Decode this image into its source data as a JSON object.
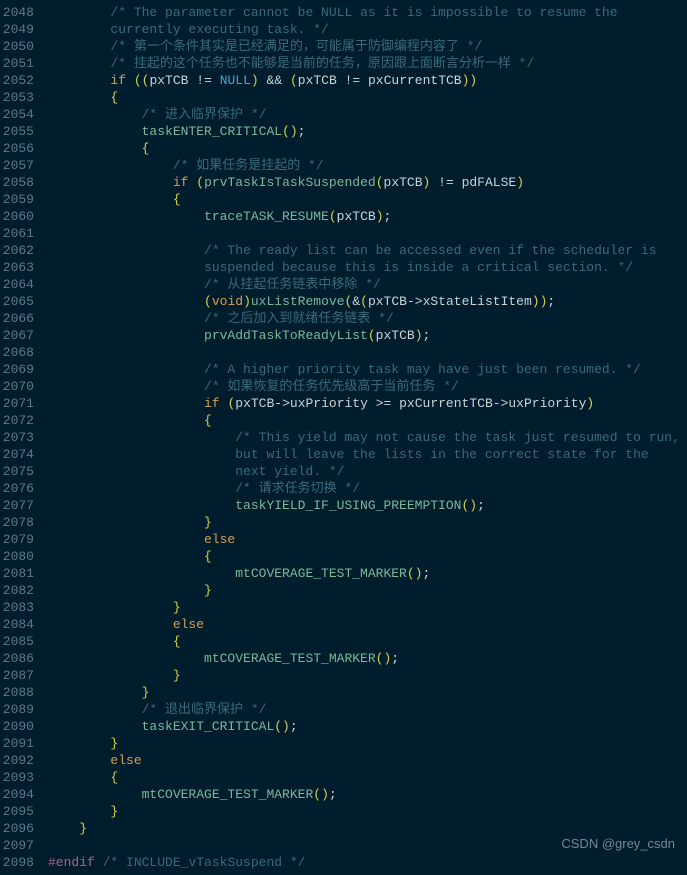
{
  "watermark": "CSDN @grey_csdn",
  "lines": [
    {
      "n": 2048,
      "i": 2,
      "seg": [
        {
          "c": "c-comment",
          "t": "/* The parameter cannot be NULL as it is impossible to resume the"
        }
      ]
    },
    {
      "n": 2049,
      "i": 2,
      "seg": [
        {
          "c": "c-comment",
          "t": "currently executing task. */"
        }
      ]
    },
    {
      "n": 2050,
      "i": 2,
      "seg": [
        {
          "c": "c-comment",
          "t": "/* 第一个条件其实是已经满足的，可能属于防御编程内容了 */"
        }
      ]
    },
    {
      "n": 2051,
      "i": 2,
      "seg": [
        {
          "c": "c-comment",
          "t": "/* 挂起的这个任务也不能够是当前的任务，原因跟上面断言分析一样 */"
        }
      ]
    },
    {
      "n": 2052,
      "i": 2,
      "seg": [
        {
          "c": "c-keyword",
          "t": "if"
        },
        {
          "c": "c-ident",
          "t": " "
        },
        {
          "c": "c-paren",
          "t": "(("
        },
        {
          "c": "c-ident",
          "t": "pxTCB "
        },
        {
          "c": "c-op",
          "t": "!="
        },
        {
          "c": "c-ident",
          "t": " "
        },
        {
          "c": "c-null",
          "t": "NULL"
        },
        {
          "c": "c-paren",
          "t": ")"
        },
        {
          "c": "c-ident",
          "t": " "
        },
        {
          "c": "c-op",
          "t": "&&"
        },
        {
          "c": "c-ident",
          "t": " "
        },
        {
          "c": "c-paren",
          "t": "("
        },
        {
          "c": "c-ident",
          "t": "pxTCB "
        },
        {
          "c": "c-op",
          "t": "!="
        },
        {
          "c": "c-ident",
          "t": " pxCurrentTCB"
        },
        {
          "c": "c-paren",
          "t": "))"
        }
      ]
    },
    {
      "n": 2053,
      "i": 2,
      "seg": [
        {
          "c": "c-brace",
          "t": "{"
        }
      ]
    },
    {
      "n": 2054,
      "i": 3,
      "seg": [
        {
          "c": "c-comment",
          "t": "/* 进入临界保护 */"
        }
      ]
    },
    {
      "n": 2055,
      "i": 3,
      "seg": [
        {
          "c": "c-func",
          "t": "taskENTER_CRITICAL"
        },
        {
          "c": "c-paren",
          "t": "()"
        },
        {
          "c": "c-punct",
          "t": ";"
        }
      ]
    },
    {
      "n": 2056,
      "i": 3,
      "seg": [
        {
          "c": "c-brace",
          "t": "{"
        }
      ]
    },
    {
      "n": 2057,
      "i": 4,
      "seg": [
        {
          "c": "c-comment",
          "t": "/* 如果任务是挂起的 */"
        }
      ]
    },
    {
      "n": 2058,
      "i": 4,
      "seg": [
        {
          "c": "c-keyword",
          "t": "if"
        },
        {
          "c": "c-ident",
          "t": " "
        },
        {
          "c": "c-paren",
          "t": "("
        },
        {
          "c": "c-func",
          "t": "prvTaskIsTaskSuspended"
        },
        {
          "c": "c-paren",
          "t": "("
        },
        {
          "c": "c-ident",
          "t": "pxTCB"
        },
        {
          "c": "c-paren",
          "t": ")"
        },
        {
          "c": "c-ident",
          "t": " "
        },
        {
          "c": "c-op",
          "t": "!="
        },
        {
          "c": "c-ident",
          "t": " pdFALSE"
        },
        {
          "c": "c-paren",
          "t": ")"
        }
      ]
    },
    {
      "n": 2059,
      "i": 4,
      "seg": [
        {
          "c": "c-brace",
          "t": "{"
        }
      ]
    },
    {
      "n": 2060,
      "i": 5,
      "seg": [
        {
          "c": "c-func",
          "t": "traceTASK_RESUME"
        },
        {
          "c": "c-paren",
          "t": "("
        },
        {
          "c": "c-ident",
          "t": "pxTCB"
        },
        {
          "c": "c-paren",
          "t": ")"
        },
        {
          "c": "c-punct",
          "t": ";"
        }
      ]
    },
    {
      "n": 2061,
      "i": 0,
      "seg": []
    },
    {
      "n": 2062,
      "i": 5,
      "seg": [
        {
          "c": "c-comment",
          "t": "/* The ready list can be accessed even if the scheduler is"
        }
      ]
    },
    {
      "n": 2063,
      "i": 5,
      "seg": [
        {
          "c": "c-comment",
          "t": "suspended because this is inside a critical section. */"
        }
      ]
    },
    {
      "n": 2064,
      "i": 5,
      "seg": [
        {
          "c": "c-comment",
          "t": "/* 从挂起任务链表中移除 */"
        }
      ]
    },
    {
      "n": 2065,
      "i": 5,
      "seg": [
        {
          "c": "c-paren",
          "t": "("
        },
        {
          "c": "c-keyword",
          "t": "void"
        },
        {
          "c": "c-paren",
          "t": ")"
        },
        {
          "c": "c-func",
          "t": "uxListRemove"
        },
        {
          "c": "c-paren",
          "t": "("
        },
        {
          "c": "c-op",
          "t": "&"
        },
        {
          "c": "c-paren",
          "t": "("
        },
        {
          "c": "c-ident",
          "t": "pxTCB"
        },
        {
          "c": "c-op",
          "t": "->"
        },
        {
          "c": "c-ident",
          "t": "xStateListItem"
        },
        {
          "c": "c-paren",
          "t": "))"
        },
        {
          "c": "c-punct",
          "t": ";"
        }
      ]
    },
    {
      "n": 2066,
      "i": 5,
      "seg": [
        {
          "c": "c-comment",
          "t": "/* 之后加入到就绪任务链表 */"
        }
      ]
    },
    {
      "n": 2067,
      "i": 5,
      "seg": [
        {
          "c": "c-func",
          "t": "prvAddTaskToReadyList"
        },
        {
          "c": "c-paren",
          "t": "("
        },
        {
          "c": "c-ident",
          "t": "pxTCB"
        },
        {
          "c": "c-paren",
          "t": ")"
        },
        {
          "c": "c-punct",
          "t": ";"
        }
      ]
    },
    {
      "n": 2068,
      "i": 0,
      "seg": []
    },
    {
      "n": 2069,
      "i": 5,
      "seg": [
        {
          "c": "c-comment",
          "t": "/* A higher priority task may have just been resumed. */"
        }
      ]
    },
    {
      "n": 2070,
      "i": 5,
      "seg": [
        {
          "c": "c-comment",
          "t": "/* 如果恢复的任务优先级高于当前任务 */"
        }
      ]
    },
    {
      "n": 2071,
      "i": 5,
      "seg": [
        {
          "c": "c-keyword",
          "t": "if"
        },
        {
          "c": "c-ident",
          "t": " "
        },
        {
          "c": "c-paren",
          "t": "("
        },
        {
          "c": "c-ident",
          "t": "pxTCB"
        },
        {
          "c": "c-op",
          "t": "->"
        },
        {
          "c": "c-ident",
          "t": "uxPriority "
        },
        {
          "c": "c-op",
          "t": ">="
        },
        {
          "c": "c-ident",
          "t": " pxCurrentTCB"
        },
        {
          "c": "c-op",
          "t": "->"
        },
        {
          "c": "c-ident",
          "t": "uxPriority"
        },
        {
          "c": "c-paren",
          "t": ")"
        }
      ]
    },
    {
      "n": 2072,
      "i": 5,
      "seg": [
        {
          "c": "c-brace",
          "t": "{"
        }
      ]
    },
    {
      "n": 2073,
      "i": 6,
      "seg": [
        {
          "c": "c-comment",
          "t": "/* This yield may not cause the task just resumed to run,"
        }
      ]
    },
    {
      "n": 2074,
      "i": 6,
      "seg": [
        {
          "c": "c-comment",
          "t": "but will leave the lists in the correct state for the"
        }
      ]
    },
    {
      "n": 2075,
      "i": 6,
      "seg": [
        {
          "c": "c-comment",
          "t": "next yield. */"
        }
      ]
    },
    {
      "n": 2076,
      "i": 6,
      "seg": [
        {
          "c": "c-comment",
          "t": "/* 请求任务切换 */"
        }
      ]
    },
    {
      "n": 2077,
      "i": 6,
      "seg": [
        {
          "c": "c-func",
          "t": "taskYIELD_IF_USING_PREEMPTION"
        },
        {
          "c": "c-paren",
          "t": "()"
        },
        {
          "c": "c-punct",
          "t": ";"
        }
      ]
    },
    {
      "n": 2078,
      "i": 5,
      "seg": [
        {
          "c": "c-brace",
          "t": "}"
        }
      ]
    },
    {
      "n": 2079,
      "i": 5,
      "seg": [
        {
          "c": "c-keyword",
          "t": "else"
        }
      ]
    },
    {
      "n": 2080,
      "i": 5,
      "seg": [
        {
          "c": "c-brace",
          "t": "{"
        }
      ]
    },
    {
      "n": 2081,
      "i": 6,
      "seg": [
        {
          "c": "c-func",
          "t": "mtCOVERAGE_TEST_MARKER"
        },
        {
          "c": "c-paren",
          "t": "()"
        },
        {
          "c": "c-punct",
          "t": ";"
        }
      ]
    },
    {
      "n": 2082,
      "i": 5,
      "seg": [
        {
          "c": "c-brace",
          "t": "}"
        }
      ]
    },
    {
      "n": 2083,
      "i": 4,
      "seg": [
        {
          "c": "c-brace",
          "t": "}"
        }
      ]
    },
    {
      "n": 2084,
      "i": 4,
      "seg": [
        {
          "c": "c-keyword",
          "t": "else"
        }
      ]
    },
    {
      "n": 2085,
      "i": 4,
      "seg": [
        {
          "c": "c-brace",
          "t": "{"
        }
      ]
    },
    {
      "n": 2086,
      "i": 5,
      "seg": [
        {
          "c": "c-func",
          "t": "mtCOVERAGE_TEST_MARKER"
        },
        {
          "c": "c-paren",
          "t": "()"
        },
        {
          "c": "c-punct",
          "t": ";"
        }
      ]
    },
    {
      "n": 2087,
      "i": 4,
      "seg": [
        {
          "c": "c-brace",
          "t": "}"
        }
      ]
    },
    {
      "n": 2088,
      "i": 3,
      "seg": [
        {
          "c": "c-brace",
          "t": "}"
        }
      ]
    },
    {
      "n": 2089,
      "i": 3,
      "seg": [
        {
          "c": "c-comment",
          "t": "/* 退出临界保护 */"
        }
      ]
    },
    {
      "n": 2090,
      "i": 3,
      "seg": [
        {
          "c": "c-func",
          "t": "taskEXIT_CRITICAL"
        },
        {
          "c": "c-paren",
          "t": "()"
        },
        {
          "c": "c-punct",
          "t": ";"
        }
      ]
    },
    {
      "n": 2091,
      "i": 2,
      "seg": [
        {
          "c": "c-brace",
          "t": "}"
        }
      ]
    },
    {
      "n": 2092,
      "i": 2,
      "seg": [
        {
          "c": "c-keyword",
          "t": "else"
        }
      ]
    },
    {
      "n": 2093,
      "i": 2,
      "seg": [
        {
          "c": "c-brace",
          "t": "{"
        }
      ]
    },
    {
      "n": 2094,
      "i": 3,
      "seg": [
        {
          "c": "c-func",
          "t": "mtCOVERAGE_TEST_MARKER"
        },
        {
          "c": "c-paren",
          "t": "()"
        },
        {
          "c": "c-punct",
          "t": ";"
        }
      ]
    },
    {
      "n": 2095,
      "i": 2,
      "seg": [
        {
          "c": "c-brace",
          "t": "}"
        }
      ]
    },
    {
      "n": 2096,
      "i": 1,
      "seg": [
        {
          "c": "c-brace",
          "t": "}"
        }
      ]
    },
    {
      "n": 2097,
      "i": 0,
      "seg": []
    },
    {
      "n": 2098,
      "i": 0,
      "seg": [
        {
          "c": "c-preproc",
          "t": "#endif"
        },
        {
          "c": "c-ident",
          "t": " "
        },
        {
          "c": "c-comment",
          "t": "/* INCLUDE_vTaskSuspend */"
        }
      ]
    }
  ]
}
